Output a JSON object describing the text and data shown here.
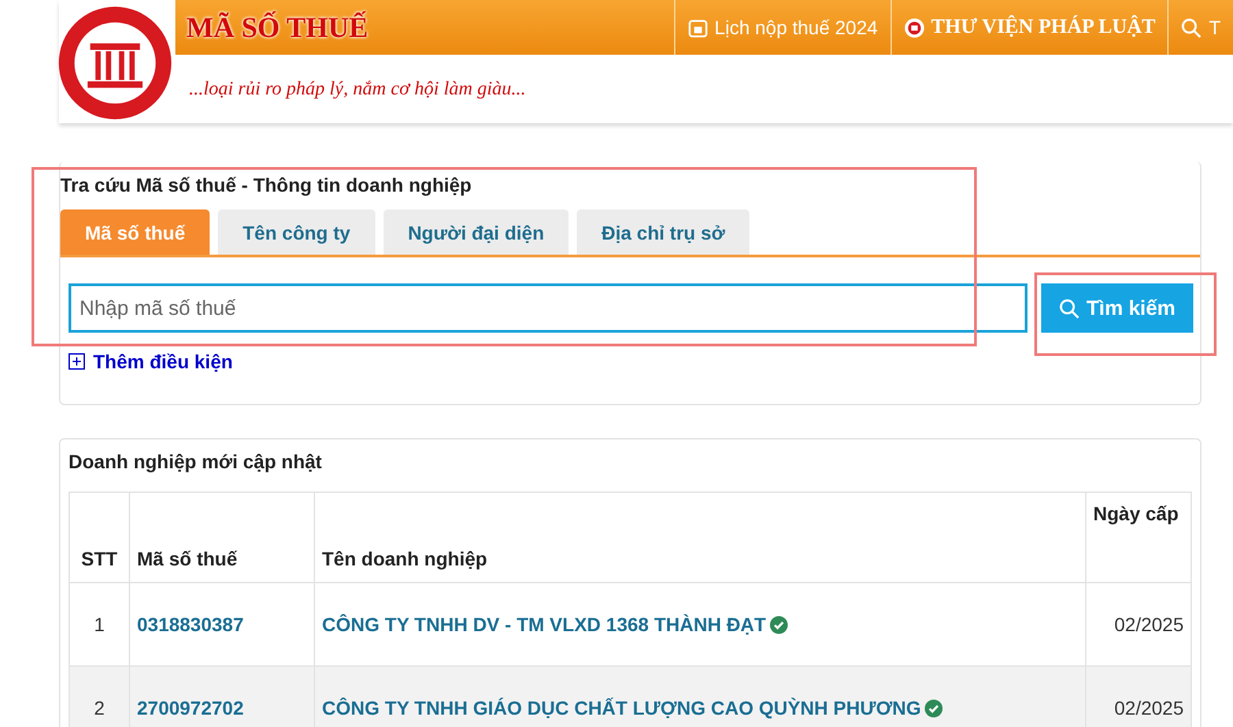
{
  "header": {
    "site_title": "MÃ SỐ THUẾ",
    "slogan": "...loại rủi ro pháp lý, nắm cơ hội làm giàu...",
    "nav": [
      {
        "kind": "calendar",
        "label": "Lịch nộp thuế 2024"
      },
      {
        "kind": "library",
        "label": "THƯ VIỆN PHÁP LUẬT"
      },
      {
        "kind": "search",
        "label": "T"
      }
    ]
  },
  "search_panel": {
    "title": "Tra cứu Mã số thuế - Thông tin doanh nghiệp",
    "tabs": [
      {
        "label": "Mã số thuế",
        "selected": true
      },
      {
        "label": "Tên công ty",
        "selected": false
      },
      {
        "label": "Người đại diện",
        "selected": false
      },
      {
        "label": "Địa chỉ trụ sở",
        "selected": false
      }
    ],
    "search_field": {
      "placeholder": "Nhập mã số thuế"
    },
    "search_button": "Tìm kiếm",
    "more_conditions": "Thêm điều kiện"
  },
  "latest_companies": {
    "title": "Doanh nghiệp mới cập nhật",
    "table": {
      "columns": [
        "STT",
        "Mã số thuế",
        "Tên doanh nghiệp",
        "Ngày cấp"
      ],
      "rows": [
        {
          "stt": "1",
          "tax_code": "0318830387",
          "name": "CÔNG TY TNHH DV - TM VLXD 1368 THÀNH ĐẠT",
          "verified": true,
          "date": "02/2025"
        },
        {
          "stt": "2",
          "tax_code": "2700972702",
          "name": "CÔNG TY TNHH GIÁO DỤC CHẤT LƯỢNG CAO QUỲNH PHƯƠNG",
          "verified": true,
          "date": "02/2025"
        }
      ]
    }
  }
}
